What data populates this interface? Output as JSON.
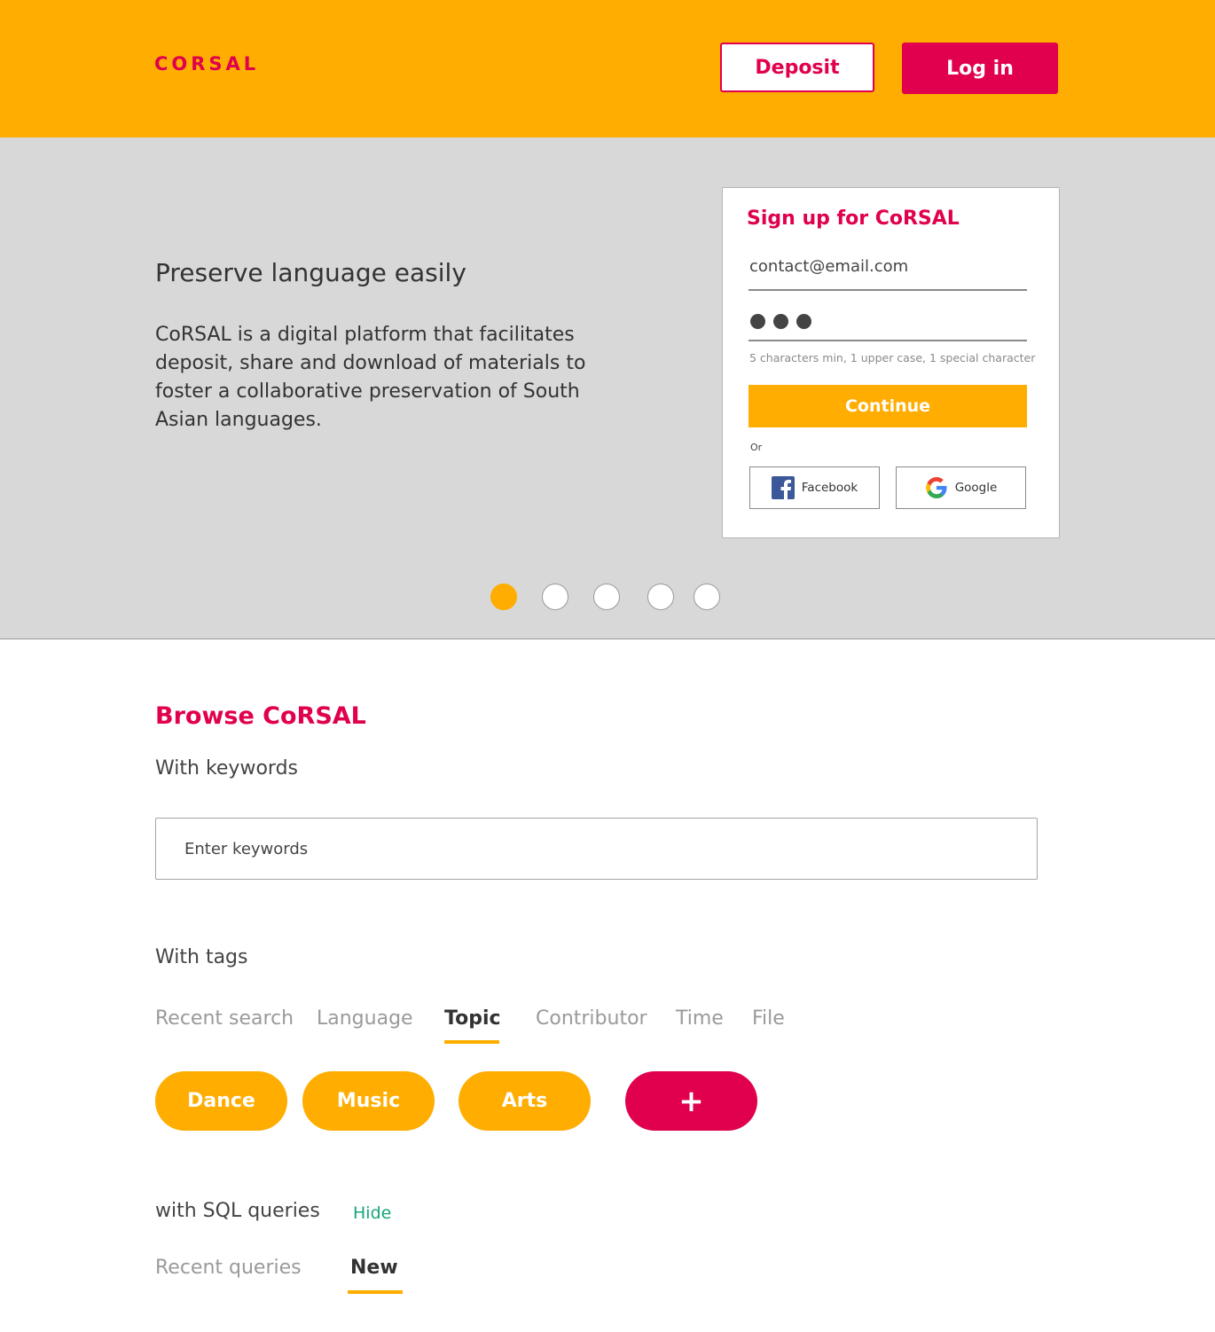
{
  "header": {
    "logo": "CORSAL",
    "deposit_label": "Deposit",
    "login_label": "Log in",
    "accent_color": "#ffad00",
    "brand_color": "#e0004d"
  },
  "hero": {
    "title": "Preserve language easily",
    "description": "CoRSAL is a digital platform that facilitates deposit, share and download of materials to foster a collaborative preservation of South Asian languages.",
    "carousel": {
      "total": 5,
      "active_index": 0
    }
  },
  "signup": {
    "title": "Sign up for CoRSAL",
    "email_value": "contact@email.com",
    "password_hint": "5 characters min, 1 upper case, 1 special character",
    "continue_label": "Continue",
    "or_label": "Or",
    "facebook_label": "Facebook",
    "google_label": "Google",
    "facebook_icon": "facebook-icon",
    "google_icon": "google-icon"
  },
  "browse": {
    "title": "Browse CoRSAL",
    "keywords_label": "With keywords",
    "search_placeholder": "Enter keywords",
    "tags_label": "With tags",
    "tabs": [
      {
        "label": "Recent search",
        "active": false
      },
      {
        "label": "Language",
        "active": false
      },
      {
        "label": "Topic",
        "active": true
      },
      {
        "label": "Contributor",
        "active": false
      },
      {
        "label": "Time",
        "active": false
      },
      {
        "label": "File",
        "active": false
      }
    ],
    "tags": [
      "Dance",
      "Music",
      "Arts"
    ],
    "add_tag_label": "+",
    "sql_label": "with SQL queries",
    "hide_label": "Hide",
    "sql_tabs": [
      {
        "label": "Recent queries",
        "active": false
      },
      {
        "label": "New",
        "active": true
      }
    ]
  }
}
